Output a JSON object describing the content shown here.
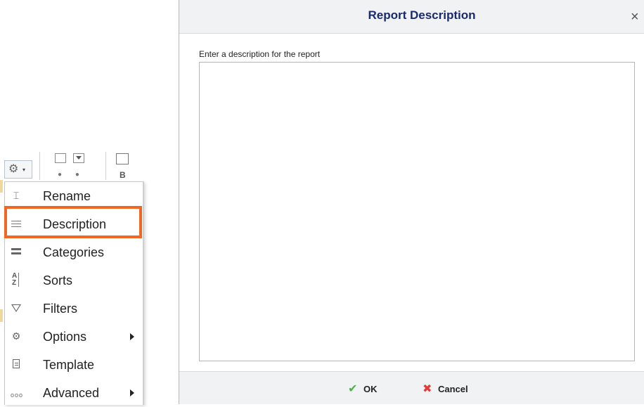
{
  "toolbar": {
    "gear_icon": "gear-icon",
    "dropdown_caret": "▾"
  },
  "menu": {
    "items": [
      {
        "label": "Rename",
        "icon": "rename-cursor-icon",
        "submenu": false
      },
      {
        "label": "Description",
        "icon": "lines-icon",
        "submenu": false,
        "highlighted": true
      },
      {
        "label": "Categories",
        "icon": "bars-icon",
        "submenu": false
      },
      {
        "label": "Sorts",
        "icon": "sort-az-icon",
        "submenu": false
      },
      {
        "label": "Filters",
        "icon": "filter-icon",
        "submenu": false
      },
      {
        "label": "Options",
        "icon": "gear-icon",
        "submenu": true
      },
      {
        "label": "Template",
        "icon": "document-icon",
        "submenu": false
      },
      {
        "label": "Advanced",
        "icon": "dots-icon",
        "submenu": true
      }
    ],
    "highlight_color": "#f26522"
  },
  "dialog": {
    "title": "Report Description",
    "close_glyph": "×",
    "prompt": "Enter a description for the report",
    "textarea_value": "",
    "buttons": {
      "ok_label": "OK",
      "cancel_label": "Cancel"
    },
    "title_color": "#1a2a6c"
  }
}
